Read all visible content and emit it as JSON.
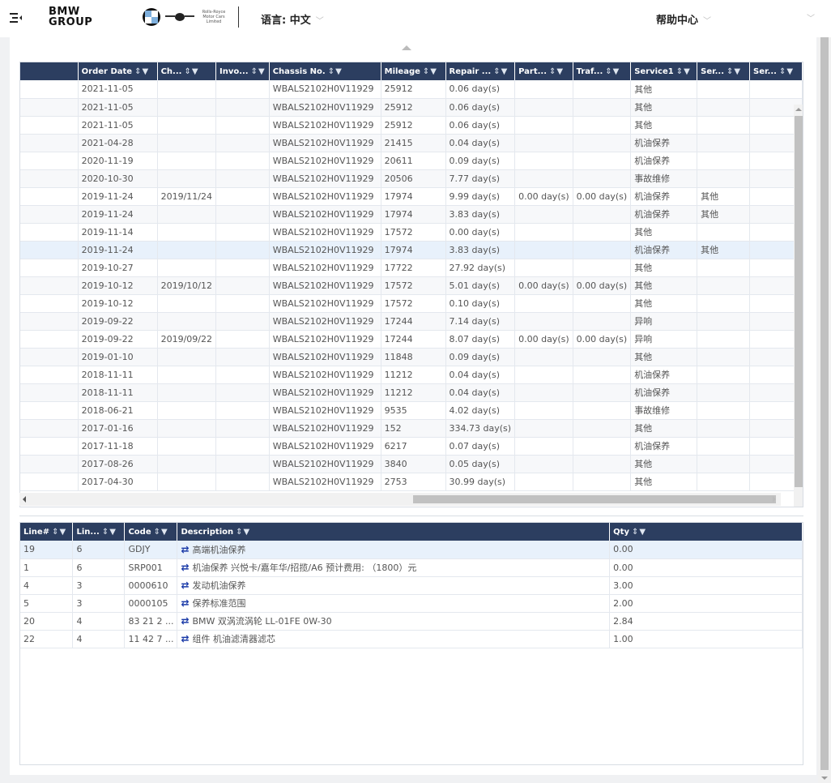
{
  "header": {
    "brand_line1": "BMW",
    "brand_line2": "GROUP",
    "rr_logo_text": "Rolls-Royce Motor Cars Limited",
    "language_label": "语言: 中文",
    "help_label": "帮助中心",
    "user_label": ""
  },
  "orders": {
    "columns": [
      "",
      "Order Date",
      "Ch...",
      "Invo...",
      "Chassis No.",
      "Mileage",
      "Repair ...",
      "Part...",
      "Traf...",
      "Service1",
      "Ser...",
      "Ser..."
    ],
    "rows": [
      [
        "",
        "2021-11-05",
        "",
        "",
        "WBALS2102H0V11929",
        "25912",
        "0.06 day(s)",
        "",
        "",
        "其他",
        "",
        ""
      ],
      [
        "",
        "2021-11-05",
        "",
        "",
        "WBALS2102H0V11929",
        "25912",
        "0.06 day(s)",
        "",
        "",
        "其他",
        "",
        ""
      ],
      [
        "",
        "2021-11-05",
        "",
        "",
        "WBALS2102H0V11929",
        "25912",
        "0.06 day(s)",
        "",
        "",
        "其他",
        "",
        ""
      ],
      [
        "",
        "2021-04-28",
        "",
        "",
        "WBALS2102H0V11929",
        "21415",
        "0.04 day(s)",
        "",
        "",
        "机油保养",
        "",
        ""
      ],
      [
        "",
        "2020-11-19",
        "",
        "",
        "WBALS2102H0V11929",
        "20611",
        "0.09 day(s)",
        "",
        "",
        "机油保养",
        "",
        ""
      ],
      [
        "",
        "2020-10-30",
        "",
        "",
        "WBALS2102H0V11929",
        "20506",
        "7.77 day(s)",
        "",
        "",
        "事故维修",
        "",
        ""
      ],
      [
        "",
        "2019-11-24",
        "2019/11/24",
        "",
        "WBALS2102H0V11929",
        "17974",
        "9.99 day(s)",
        "0.00 day(s)",
        "0.00 day(s)",
        "机油保养",
        "其他",
        ""
      ],
      [
        "",
        "2019-11-24",
        "",
        "",
        "WBALS2102H0V11929",
        "17974",
        "3.83 day(s)",
        "",
        "",
        "机油保养",
        "其他",
        ""
      ],
      [
        "",
        "2019-11-14",
        "",
        "",
        "WBALS2102H0V11929",
        "17572",
        "0.00 day(s)",
        "",
        "",
        "其他",
        "",
        ""
      ],
      [
        "",
        "2019-11-24",
        "",
        "",
        "WBALS2102H0V11929",
        "17974",
        "3.83 day(s)",
        "",
        "",
        "机油保养",
        "其他",
        ""
      ],
      [
        "",
        "2019-10-27",
        "",
        "",
        "WBALS2102H0V11929",
        "17722",
        "27.92 day(s)",
        "",
        "",
        "其他",
        "",
        ""
      ],
      [
        "",
        "2019-10-12",
        "2019/10/12",
        "",
        "WBALS2102H0V11929",
        "17572",
        "5.01 day(s)",
        "0.00 day(s)",
        "0.00 day(s)",
        "其他",
        "",
        ""
      ],
      [
        "",
        "2019-10-12",
        "",
        "",
        "WBALS2102H0V11929",
        "17572",
        "0.10 day(s)",
        "",
        "",
        "其他",
        "",
        ""
      ],
      [
        "",
        "2019-09-22",
        "",
        "",
        "WBALS2102H0V11929",
        "17244",
        "7.14 day(s)",
        "",
        "",
        "异响",
        "",
        ""
      ],
      [
        "",
        "2019-09-22",
        "2019/09/22",
        "",
        "WBALS2102H0V11929",
        "17244",
        "8.07 day(s)",
        "0.00 day(s)",
        "0.00 day(s)",
        "异响",
        "",
        ""
      ],
      [
        "",
        "2019-01-10",
        "",
        "",
        "WBALS2102H0V11929",
        "11848",
        "0.09 day(s)",
        "",
        "",
        "其他",
        "",
        ""
      ],
      [
        "",
        "2018-11-11",
        "",
        "",
        "WBALS2102H0V11929",
        "11212",
        "0.04 day(s)",
        "",
        "",
        "机油保养",
        "",
        ""
      ],
      [
        "",
        "2018-11-11",
        "",
        "",
        "WBALS2102H0V11929",
        "11212",
        "0.04 day(s)",
        "",
        "",
        "机油保养",
        "",
        ""
      ],
      [
        "",
        "2018-06-21",
        "",
        "",
        "WBALS2102H0V11929",
        "9535",
        "4.02 day(s)",
        "",
        "",
        "事故维修",
        "",
        ""
      ],
      [
        "",
        "2017-01-16",
        "",
        "",
        "WBALS2102H0V11929",
        "152",
        "334.73 day(s)",
        "",
        "",
        "其他",
        "",
        ""
      ],
      [
        "",
        "2017-11-18",
        "",
        "",
        "WBALS2102H0V11929",
        "6217",
        "0.07 day(s)",
        "",
        "",
        "机油保养",
        "",
        ""
      ],
      [
        "",
        "2017-08-26",
        "",
        "",
        "WBALS2102H0V11929",
        "3840",
        "0.05 day(s)",
        "",
        "",
        "其他",
        "",
        ""
      ],
      [
        "",
        "2017-04-30",
        "",
        "",
        "WBALS2102H0V11929",
        "2753",
        "30.99 day(s)",
        "",
        "",
        "其他",
        "",
        ""
      ]
    ],
    "selected_row": 9
  },
  "lines": {
    "columns": [
      "Line#",
      "Lin...",
      "Code",
      "Description",
      "Qty"
    ],
    "rows": [
      [
        "19",
        "6",
        "GDJY",
        "高端机油保养",
        "0.00"
      ],
      [
        "1",
        "6",
        "SRP001",
        "机油保养 兴悦卡/嘉年华/招揽/A6 预计费用: （1800）元",
        "0.00"
      ],
      [
        "4",
        "3",
        "0000610",
        "发动机油保养",
        "3.00"
      ],
      [
        "5",
        "3",
        "0000105",
        "保养标准范围",
        "2.00"
      ],
      [
        "20",
        "4",
        "83 21 2 ...",
        "BMW 双涡流涡轮 LL-01FE 0W-30",
        "2.84"
      ],
      [
        "22",
        "4",
        "11 42 7 ...",
        "组件 机油滤清器滤芯",
        "1.00"
      ]
    ]
  },
  "icons": {
    "sort_filter": "sort-filter-icon",
    "swap": "swap-arrows-icon",
    "menu": "menu-icon"
  },
  "colors": {
    "header_bg": "#2c3e60",
    "swap_icon": "#1a3aa8",
    "selected_row": "#e8f1fb"
  }
}
